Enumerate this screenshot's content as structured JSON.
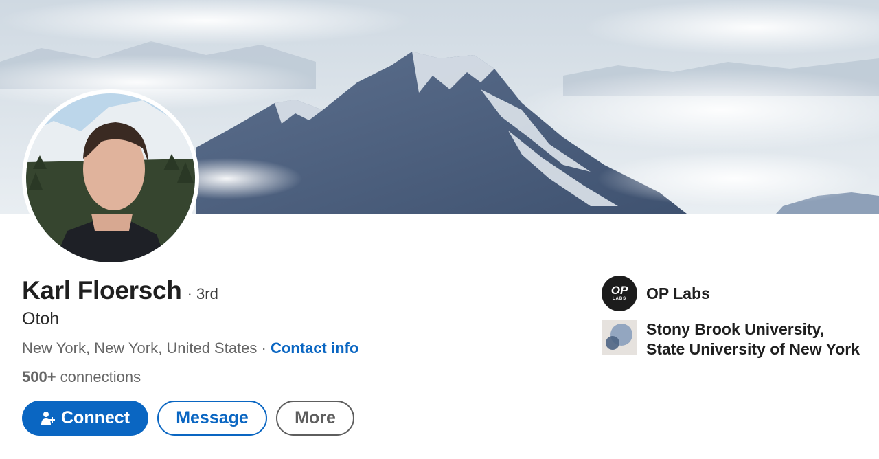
{
  "banner": {
    "alt_icon": "mountain-banner-image"
  },
  "profile": {
    "avatar_icon": "profile-photo",
    "name": "Karl Floersch",
    "degree": "· 3rd",
    "headline": "Otoh",
    "location": "New York, New York, United States",
    "separator": " · ",
    "contact_info": "Contact info",
    "connections_count": "500+",
    "connections_label": " connections"
  },
  "actions": {
    "connect_label": "Connect",
    "connect_icon": "add-person-icon",
    "message_label": "Message",
    "more_label": "More"
  },
  "sidebar": {
    "orgs": [
      {
        "name": "OP Labs",
        "logo_text_top": "OP",
        "logo_text_bottom": "LABS"
      },
      {
        "name": "Stony Brook University, State University of New York"
      }
    ]
  },
  "colors": {
    "accent": "#0a66c2",
    "text": "#1f1f1f",
    "muted": "#666666"
  }
}
